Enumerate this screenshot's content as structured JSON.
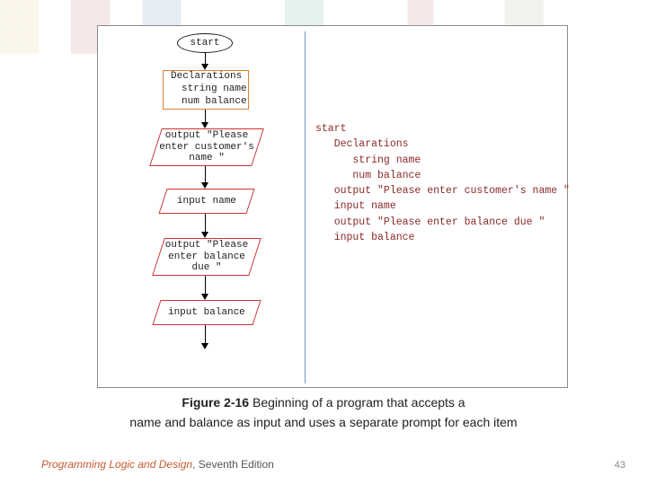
{
  "flowchart": {
    "start": "start",
    "declarations_l1": "Declarations",
    "declarations_l2": "string name",
    "declarations_l3": "num balance",
    "out1_l1": "output \"Please",
    "out1_l2": "enter customer's",
    "out1_l3": "name \"",
    "input1": "input name",
    "out2_l1": "output \"Please",
    "out2_l2": "enter balance",
    "out2_l3": "due \"",
    "input2": "input balance"
  },
  "pseudocode": {
    "l1": "start",
    "l2": "   Declarations",
    "l3": "      string name",
    "l4": "      num balance",
    "l5": "   output \"Please enter customer's name \"",
    "l6": "   input name",
    "l7": "   output \"Please enter balance due \"",
    "l8": "   input balance"
  },
  "caption": {
    "label": "Figure 2-16",
    "line1_rest": " Beginning of a program that accepts a",
    "line2": "name and balance as input and uses a separate prompt for each item"
  },
  "footer": {
    "title": "Programming Logic and Design",
    "tail": ", Seventh Edition"
  },
  "page_number": "43"
}
